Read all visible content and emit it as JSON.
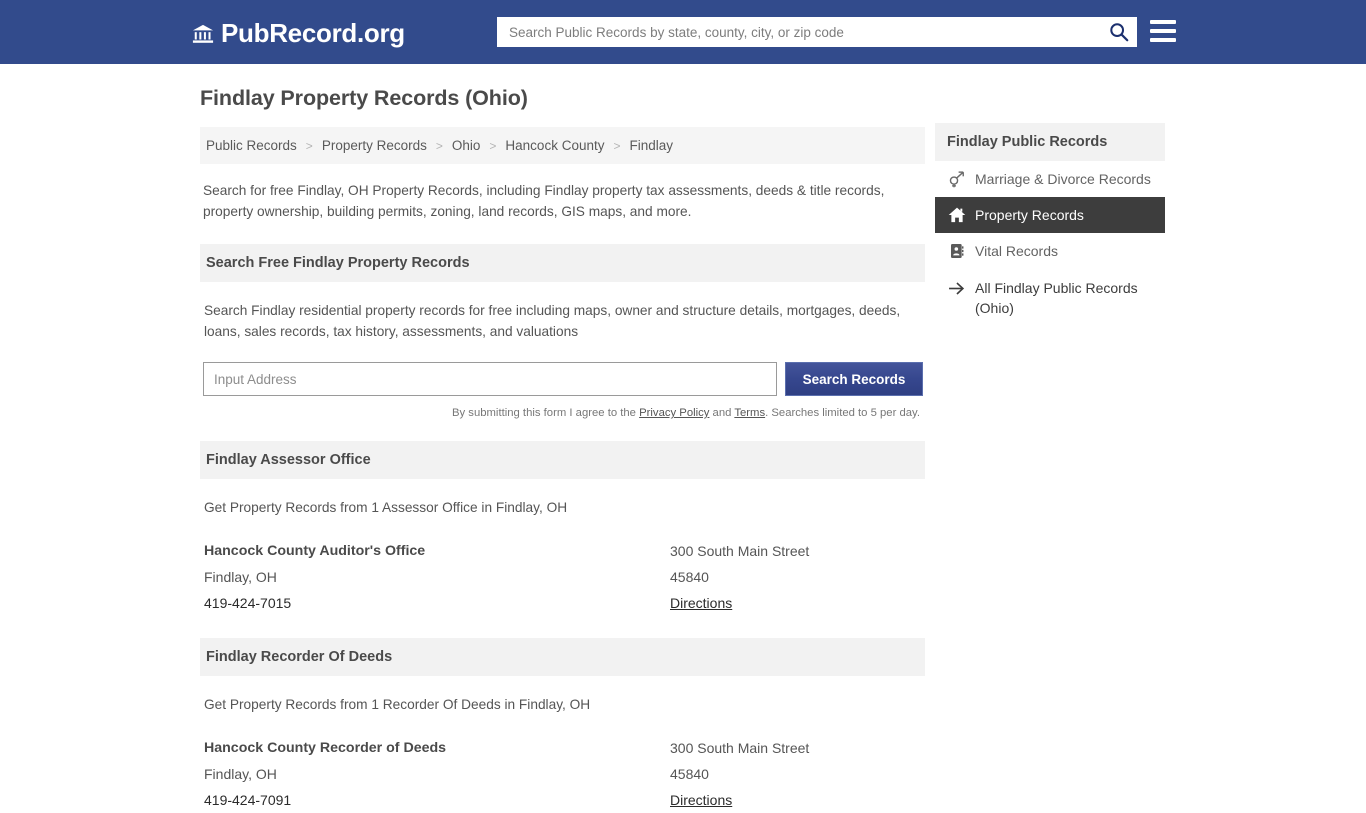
{
  "header": {
    "brand": "PubRecord.org",
    "brand_icon": "bank-icon",
    "search_placeholder": "Search Public Records by state, county, city, or zip code",
    "search_value": "",
    "search_icon": "search-icon",
    "menu_icon": "hamburger-menu-icon",
    "background_color": "#324b8c"
  },
  "page": {
    "title": "Findlay Property Records (Ohio)",
    "intro": "Search for free Findlay, OH Property Records, including Findlay property tax assessments, deeds & title records, property ownership, building permits, zoning, land records, GIS maps, and more."
  },
  "breadcrumb": {
    "separator": ">",
    "items": [
      {
        "label": "Public Records"
      },
      {
        "label": "Property Records"
      },
      {
        "label": "Ohio"
      },
      {
        "label": "Hancock County"
      },
      {
        "label": "Findlay"
      }
    ]
  },
  "search_section": {
    "heading": "Search Free Findlay Property Records",
    "description": "Search Findlay residential property records for free including maps, owner and structure details, mortgages, deeds, loans, sales records, tax history, assessments, and valuations",
    "input_placeholder": "Input Address",
    "input_value": "",
    "button_label": "Search Records",
    "button_color": "#36478e",
    "disclaimer_prefix": "By submitting this form I agree to the ",
    "disclaimer_privacy": "Privacy Policy",
    "disclaimer_middle": " and ",
    "disclaimer_terms": "Terms",
    "disclaimer_suffix": ". Searches limited to 5 per day."
  },
  "sections": [
    {
      "heading": "Findlay Assessor Office",
      "description": "Get Property Records from 1 Assessor Office in Findlay, OH",
      "office": {
        "name": "Hancock County Auditor's Office",
        "city_state": "Findlay, OH",
        "phone": "419-424-7015",
        "street": "300 South Main Street",
        "zip": "45840",
        "directions_label": "Directions"
      }
    },
    {
      "heading": "Findlay Recorder Of Deeds",
      "description": "Get Property Records from 1 Recorder Of Deeds in Findlay, OH",
      "office": {
        "name": "Hancock County Recorder of Deeds",
        "city_state": "Findlay, OH",
        "phone": "419-424-7091",
        "street": "300 South Main Street",
        "zip": "45840",
        "directions_label": "Directions"
      }
    }
  ],
  "sidebar": {
    "title": "Findlay Public Records",
    "items": [
      {
        "label": "Marriage & Divorce Records",
        "icon": "venus-mars-icon",
        "active": false
      },
      {
        "label": "Property Records",
        "icon": "home-icon",
        "active": true
      },
      {
        "label": "Vital Records",
        "icon": "address-book-icon",
        "active": false
      },
      {
        "label": "All Findlay Public Records (Ohio)",
        "icon": "arrow-right-icon",
        "active": false
      }
    ],
    "active_background": "#3d3d3d"
  }
}
